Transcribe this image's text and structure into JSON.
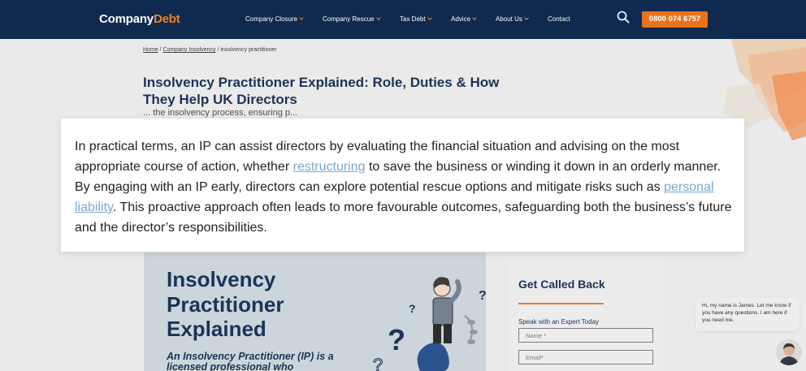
{
  "header": {
    "logo_main": "Company",
    "logo_accent": "Debt",
    "nav": [
      {
        "label": "Company Closure",
        "has_dropdown": true
      },
      {
        "label": "Company Rescue",
        "has_dropdown": true
      },
      {
        "label": "Tax Debt",
        "has_dropdown": true
      },
      {
        "label": "Advice",
        "has_dropdown": true
      },
      {
        "label": "About Us",
        "has_dropdown": true
      },
      {
        "label": "Contact",
        "has_dropdown": false
      }
    ],
    "search_icon": "search-icon",
    "phone": "0800 074 6757"
  },
  "breadcrumb": {
    "home": "Home",
    "sep1": " / ",
    "section": "Company Insolvency",
    "sep2": " / ",
    "current": "insolvency practitioner"
  },
  "article": {
    "title": "Insolvency Practitioner Explained: Role, Duties & How They Help UK Directors",
    "behind_text": "... the insolvency process, ensuring p..."
  },
  "paragraph": {
    "part1": "In practical terms, an IP can assist directors by evaluating the financial situation and advising on the most appropriate course of action, whether ",
    "link1": "restructuring",
    "part2": " to save the business or winding it down in an orderly manner. By engaging with an IP early, directors can explore potential rescue options and mitigate risks such as ",
    "link2": "personal liability",
    "part3": ". This proactive approach often leads to more favourable outcomes, safeguarding both the business’s future and the director’s responsibilities."
  },
  "infographic": {
    "title": "Insolvency Practitioner Explained",
    "subtitle": "An Insolvency Practitioner (IP) is a licensed professional who"
  },
  "callback": {
    "title": "Get Called Back",
    "label": "Speak with an Expert Today",
    "name_placeholder": "Name *",
    "email_placeholder": "Email*"
  },
  "chat": {
    "message": "Hi, my name is James. Let me know if you have any questions. I am here if you need me."
  },
  "colors": {
    "navy": "#0f2a4e",
    "orange": "#e8731c",
    "link": "#79a7d3"
  }
}
